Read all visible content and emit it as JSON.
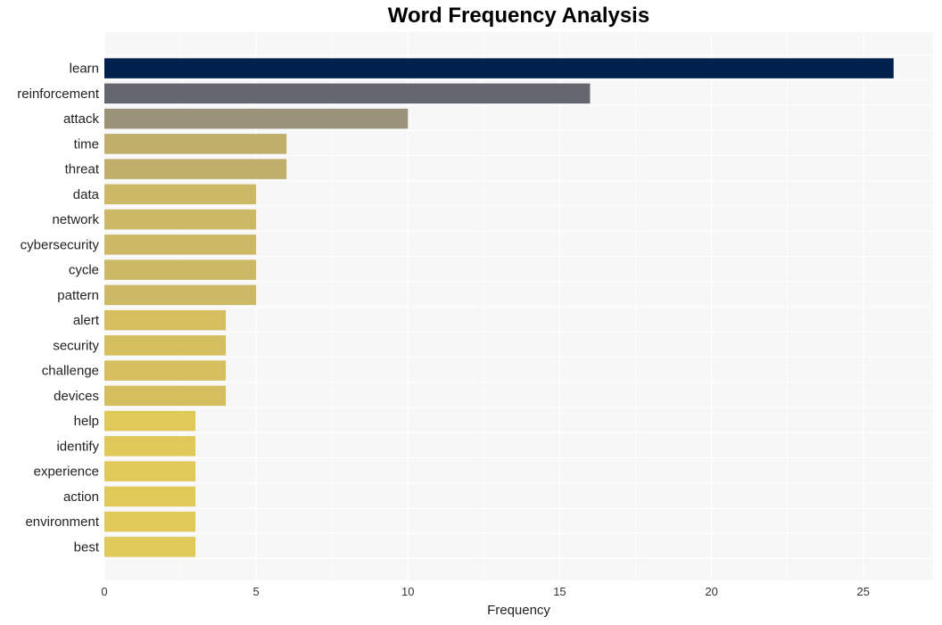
{
  "chart_data": {
    "type": "bar",
    "orientation": "horizontal",
    "title": "Word Frequency Analysis",
    "xlabel": "Frequency",
    "ylabel": "",
    "xlim": [
      0,
      27.3
    ],
    "xticks": [
      0,
      5,
      10,
      15,
      20,
      25
    ],
    "grid": true,
    "categories": [
      "learn",
      "reinforcement",
      "attack",
      "time",
      "threat",
      "data",
      "network",
      "cybersecurity",
      "cycle",
      "pattern",
      "alert",
      "security",
      "challenge",
      "devices",
      "help",
      "identify",
      "experience",
      "action",
      "environment",
      "best"
    ],
    "values": [
      26,
      16,
      10,
      6,
      6,
      5,
      5,
      5,
      5,
      5,
      4,
      4,
      4,
      4,
      3,
      3,
      3,
      3,
      3,
      3
    ],
    "colors": [
      "#00214d",
      "#646670",
      "#9a9279",
      "#c0af6b",
      "#c0af6b",
      "#cbb966",
      "#cbb966",
      "#cbb966",
      "#cbb966",
      "#cbb966",
      "#d5be5e",
      "#d5be5e",
      "#d5be5e",
      "#d5be5e",
      "#e0c959",
      "#e0c959",
      "#e0c959",
      "#e0c959",
      "#e0c959",
      "#e0c959"
    ],
    "background": "#f7f7f7"
  }
}
